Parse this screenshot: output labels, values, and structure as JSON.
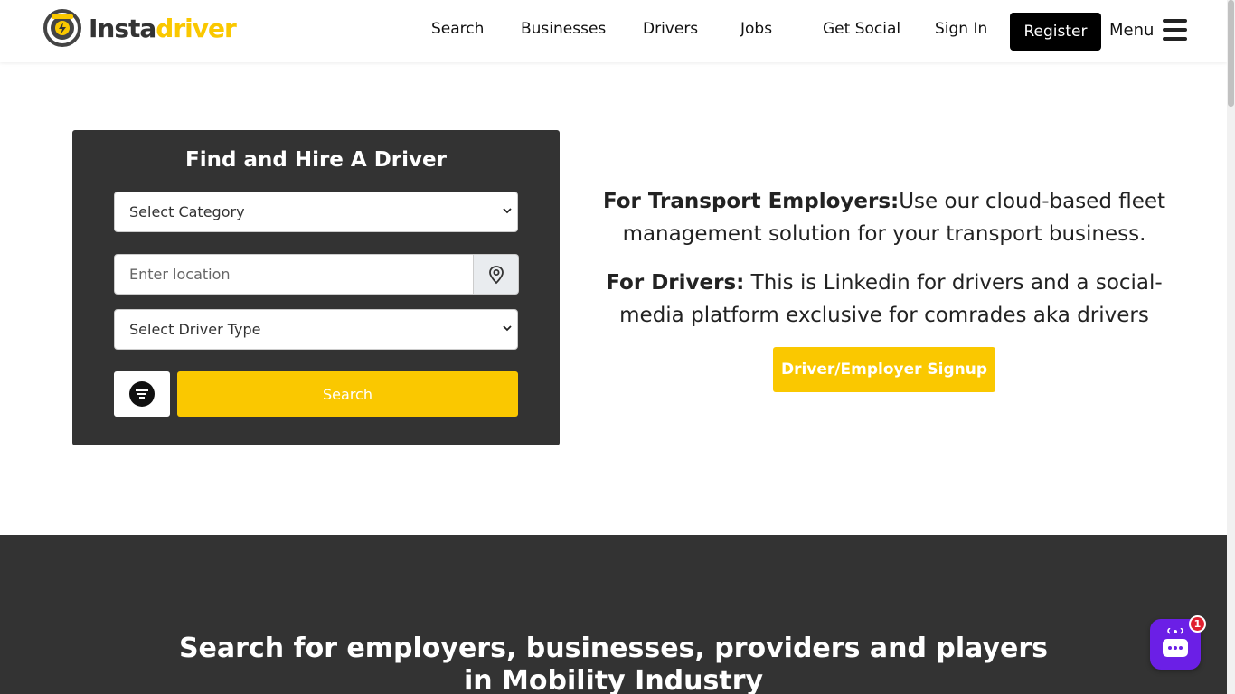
{
  "brand": {
    "name_part1": "Insta",
    "name_part2": "driver",
    "color": "#fac800"
  },
  "nav": {
    "links": [
      "Search",
      "Businesses",
      "Drivers",
      "Jobs",
      "Get Social",
      "Sign In"
    ],
    "register": "Register",
    "menu": "Menu"
  },
  "search_panel": {
    "title": "Find and Hire A Driver",
    "category_select": "Select Category",
    "location_placeholder": "Enter location",
    "driver_type_select": "Select Driver Type",
    "search_button": "Search"
  },
  "info": {
    "employers_label": "For Transport Employers:",
    "employers_text": "Use our cloud-based fleet management solution for your transport business.",
    "drivers_label": "For Drivers:",
    "drivers_text": " This is Linkedin for drivers and a social-media platform exclusive for comrades aka drivers",
    "signup_button": "Driver/Employer Signup"
  },
  "section2": {
    "title_line1": "Search for employers, businesses, providers and players",
    "title_line2": "in Mobility Industry"
  },
  "chat": {
    "badge": "1",
    "icon": "chat-icon"
  },
  "colors": {
    "accent": "#fac800",
    "dark": "#333333",
    "chat": "#6b1fe6"
  }
}
